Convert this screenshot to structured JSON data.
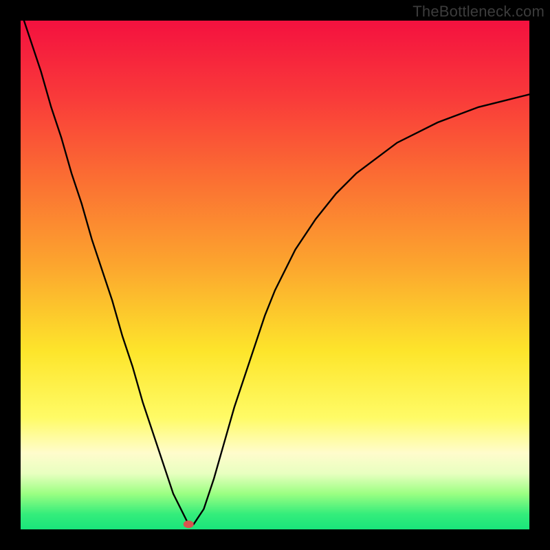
{
  "watermark": "TheBottleneck.com",
  "chart_data": {
    "type": "line",
    "title": "",
    "xlabel": "",
    "ylabel": "",
    "xlim": [
      0,
      100
    ],
    "ylim": [
      0,
      100
    ],
    "grid": false,
    "legend": false,
    "series": [
      {
        "name": "left-branch",
        "x": [
          0,
          2,
          4,
          6,
          8,
          10,
          12,
          14,
          16,
          18,
          20,
          22,
          24,
          26,
          28,
          30,
          32,
          33
        ],
        "y": [
          102,
          96,
          90,
          83,
          77,
          70,
          64,
          57,
          51,
          45,
          38,
          32,
          25,
          19,
          13,
          7,
          3,
          1
        ]
      },
      {
        "name": "right-branch",
        "x": [
          33,
          34,
          36,
          38,
          40,
          42,
          44,
          46,
          48,
          50,
          54,
          58,
          62,
          66,
          70,
          74,
          78,
          82,
          86,
          90,
          94,
          98,
          100
        ],
        "y": [
          1,
          1,
          4,
          10,
          17,
          24,
          30,
          36,
          42,
          47,
          55,
          61,
          66,
          70,
          73,
          76,
          78,
          80,
          81.5,
          83,
          84,
          85,
          85.5
        ]
      }
    ],
    "marker": {
      "x": 33,
      "y": 1
    }
  }
}
